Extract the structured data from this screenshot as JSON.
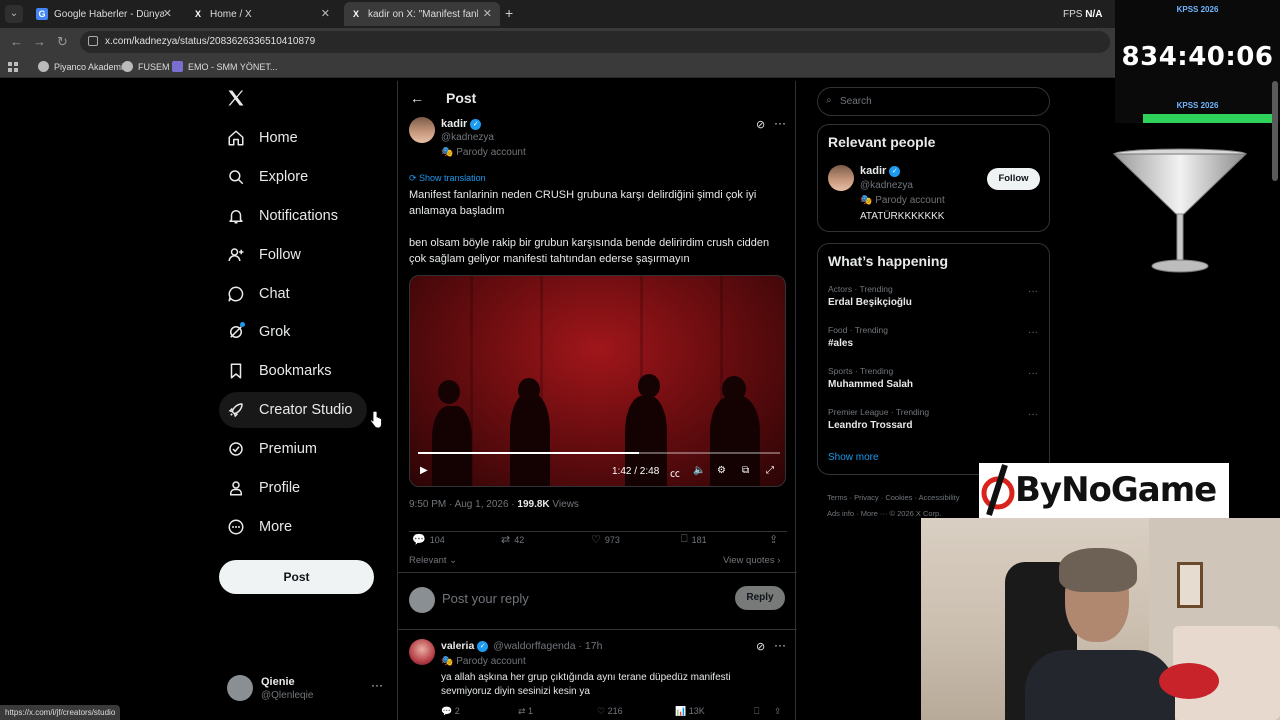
{
  "browser": {
    "tabs": [
      {
        "title": "Google Haberler - Dünya - En y",
        "icon": "G"
      },
      {
        "title": "Home / X",
        "icon": "X"
      },
      {
        "title": "kadir on X: \"Manifest fanlarının",
        "icon": "X"
      }
    ],
    "fps_label": "FPS",
    "fps_value": "N/A",
    "url": "x.com/kadnezya/status/2083626336510410879",
    "bookmarks": [
      "Piyanco Akademi",
      "FUSEM",
      "EMO - SMM YÖNET..."
    ],
    "status_url": "https://x.com/i/jf/creators/studio"
  },
  "nav": {
    "items": [
      {
        "label": "Home",
        "icon": "home-icon"
      },
      {
        "label": "Explore",
        "icon": "search-icon"
      },
      {
        "label": "Notifications",
        "icon": "bell-icon"
      },
      {
        "label": "Follow",
        "icon": "follow-icon"
      },
      {
        "label": "Chat",
        "icon": "chat-icon"
      },
      {
        "label": "Grok",
        "icon": "grok-icon"
      },
      {
        "label": "Bookmarks",
        "icon": "bookmark-icon"
      },
      {
        "label": "Creator Studio",
        "icon": "rocket-icon"
      },
      {
        "label": "Premium",
        "icon": "premium-icon"
      },
      {
        "label": "Profile",
        "icon": "person-icon"
      },
      {
        "label": "More",
        "icon": "more-circle-icon"
      }
    ],
    "post_button": "Post",
    "account": {
      "name": "Qienie",
      "handle": "@Qlenleqie"
    }
  },
  "post": {
    "page_title": "Post",
    "author": {
      "name": "kadir",
      "handle": "@kadnezya",
      "badge": "Parody account"
    },
    "show_translation": "Show translation",
    "text_1": "Manifest fanlarinin neden CRUSH grubuna karşı delirdiğini şimdi çok iyi anlamaya başladım",
    "text_2": "ben olsam böyle rakip bir grubun karşısında bende delirirdim crush cidden çok sağlam geliyor manifesti tahtından ederse şaşırmayın",
    "video": {
      "time": "1:42 / 2:48",
      "progress": 0.61
    },
    "timestamp": "9:50 PM · Aug 1, 2026 · ",
    "views": "199.8K",
    "views_label": " Views",
    "stats": {
      "replies": "104",
      "reposts": "42",
      "likes": "973",
      "bookmarks": "181"
    },
    "relevant": "Relevant",
    "view_quotes": "View quotes",
    "reply_placeholder": "Post your reply",
    "reply_button": "Reply"
  },
  "reply": {
    "name": "valeria",
    "handle": "@waldorffagenda · 17h",
    "badge": "Parody account",
    "text": "ya allah aşkına her grup çıktığında aynı terane düpedüz manifesti sevmiyoruz diyin sesinizi kesin ya",
    "stats": {
      "replies": "2",
      "reposts": "1",
      "likes": "216",
      "views": "13K"
    }
  },
  "sidebar": {
    "search_placeholder": "Search",
    "relevant_title": "Relevant people",
    "relevant_person": {
      "name": "kadir",
      "handle": "@kadnezya",
      "badge": "Parody account",
      "bio": "ATATÜRKKKKKKK",
      "follow": "Follow"
    },
    "happening_title": "What’s happening",
    "trends": [
      {
        "category": "Actors · Trending",
        "name": "Erdal Beşikçioğlu"
      },
      {
        "category": "Food · Trending",
        "name": "#ales"
      },
      {
        "category": "Sports · Trending",
        "name": "Muhammed Salah"
      },
      {
        "category": "Premier League · Trending",
        "name": "Leandro Trossard"
      }
    ],
    "show_more": "Show more",
    "footer_1": "Terms · Privacy · Cookies · Accessibility",
    "footer_2": "Ads info · More ··· © 2026 X Corp."
  },
  "overlay": {
    "kpss_top": "KPSS 2026",
    "timer": "834:40:06",
    "kpss_bottom": "KPSS 2026",
    "brand": "ByNoGame"
  }
}
